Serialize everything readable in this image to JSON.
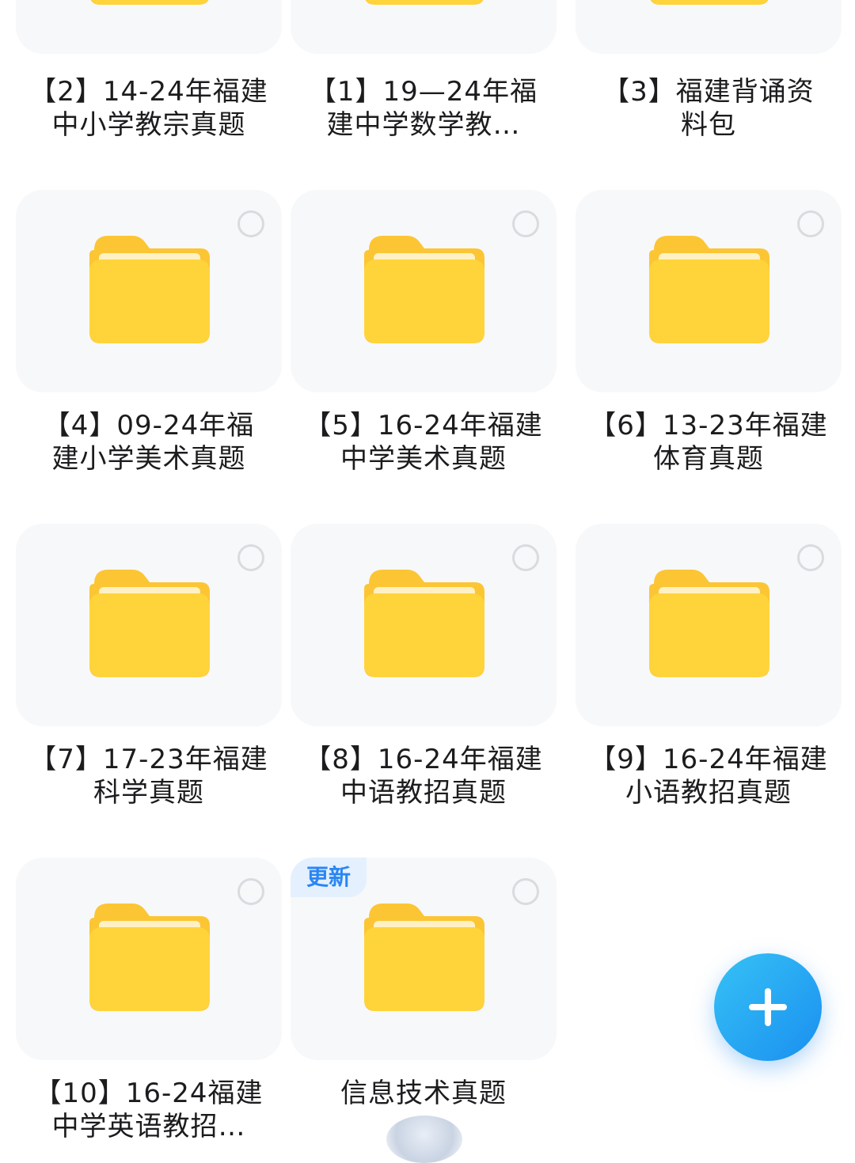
{
  "folders": [
    {
      "label_line1": "【2】14-24年福建",
      "label_line2": "中小学教宗真题"
    },
    {
      "label_line1": "【1】19—24年福",
      "label_line2": "建中学数学教…"
    },
    {
      "label_line1": "【3】福建背诵资",
      "label_line2": "料包"
    },
    {
      "label_line1": "【4】09-24年福",
      "label_line2": "建小学美术真题"
    },
    {
      "label_line1": "【5】16-24年福建",
      "label_line2": "中学美术真题"
    },
    {
      "label_line1": "【6】13-23年福建",
      "label_line2": "体育真题"
    },
    {
      "label_line1": "【7】17-23年福建",
      "label_line2": "科学真题"
    },
    {
      "label_line1": "【8】16-24年福建",
      "label_line2": "中语教招真题"
    },
    {
      "label_line1": "【9】16-24年福建",
      "label_line2": "小语教招真题"
    },
    {
      "label_line1": "【10】16-24福建",
      "label_line2": "中学英语教招…"
    },
    {
      "label_line1": "信息技术真题",
      "label_line2": "",
      "badge": "更新"
    }
  ],
  "colors": {
    "folder_main": "#ffd43b",
    "folder_tab": "#fcc534",
    "accent_blue": "#1a8ff0",
    "badge_bg": "#e4f0fd"
  },
  "icons": {
    "folder": "folder-icon",
    "select": "select-circle-icon",
    "add": "plus-icon"
  }
}
